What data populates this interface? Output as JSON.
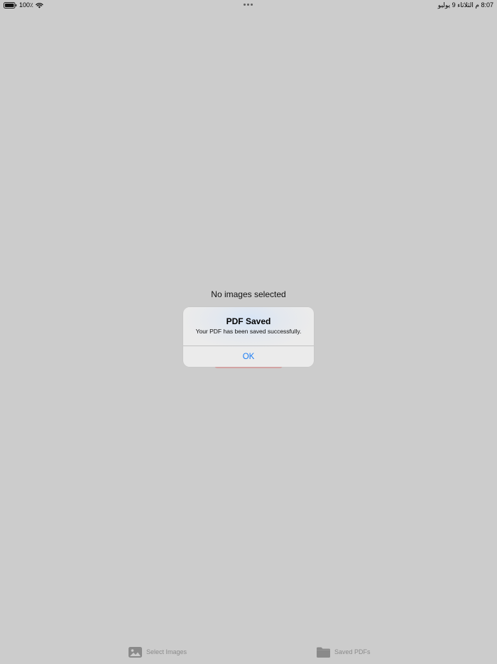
{
  "status_bar": {
    "battery": "100٪",
    "time_date": "8:07 م  الثلاثاء 9 يوليو",
    "icons": [
      "battery-icon",
      "wifi-icon",
      "multitask-dots-icon"
    ]
  },
  "main": {
    "empty_message": "No images selected"
  },
  "alert": {
    "title": "PDF Saved",
    "message": "Your PDF has been saved successfully.",
    "ok_label": "OK",
    "accent_color": "#1a7cf5"
  },
  "tab_bar": {
    "tabs": [
      {
        "label": "Select Images",
        "icon": "photo-icon"
      },
      {
        "label": "Saved PDFs",
        "icon": "folder-icon"
      }
    ],
    "inactive_color": "#8a8a8a"
  },
  "colors": {
    "background": "#cccccc"
  }
}
